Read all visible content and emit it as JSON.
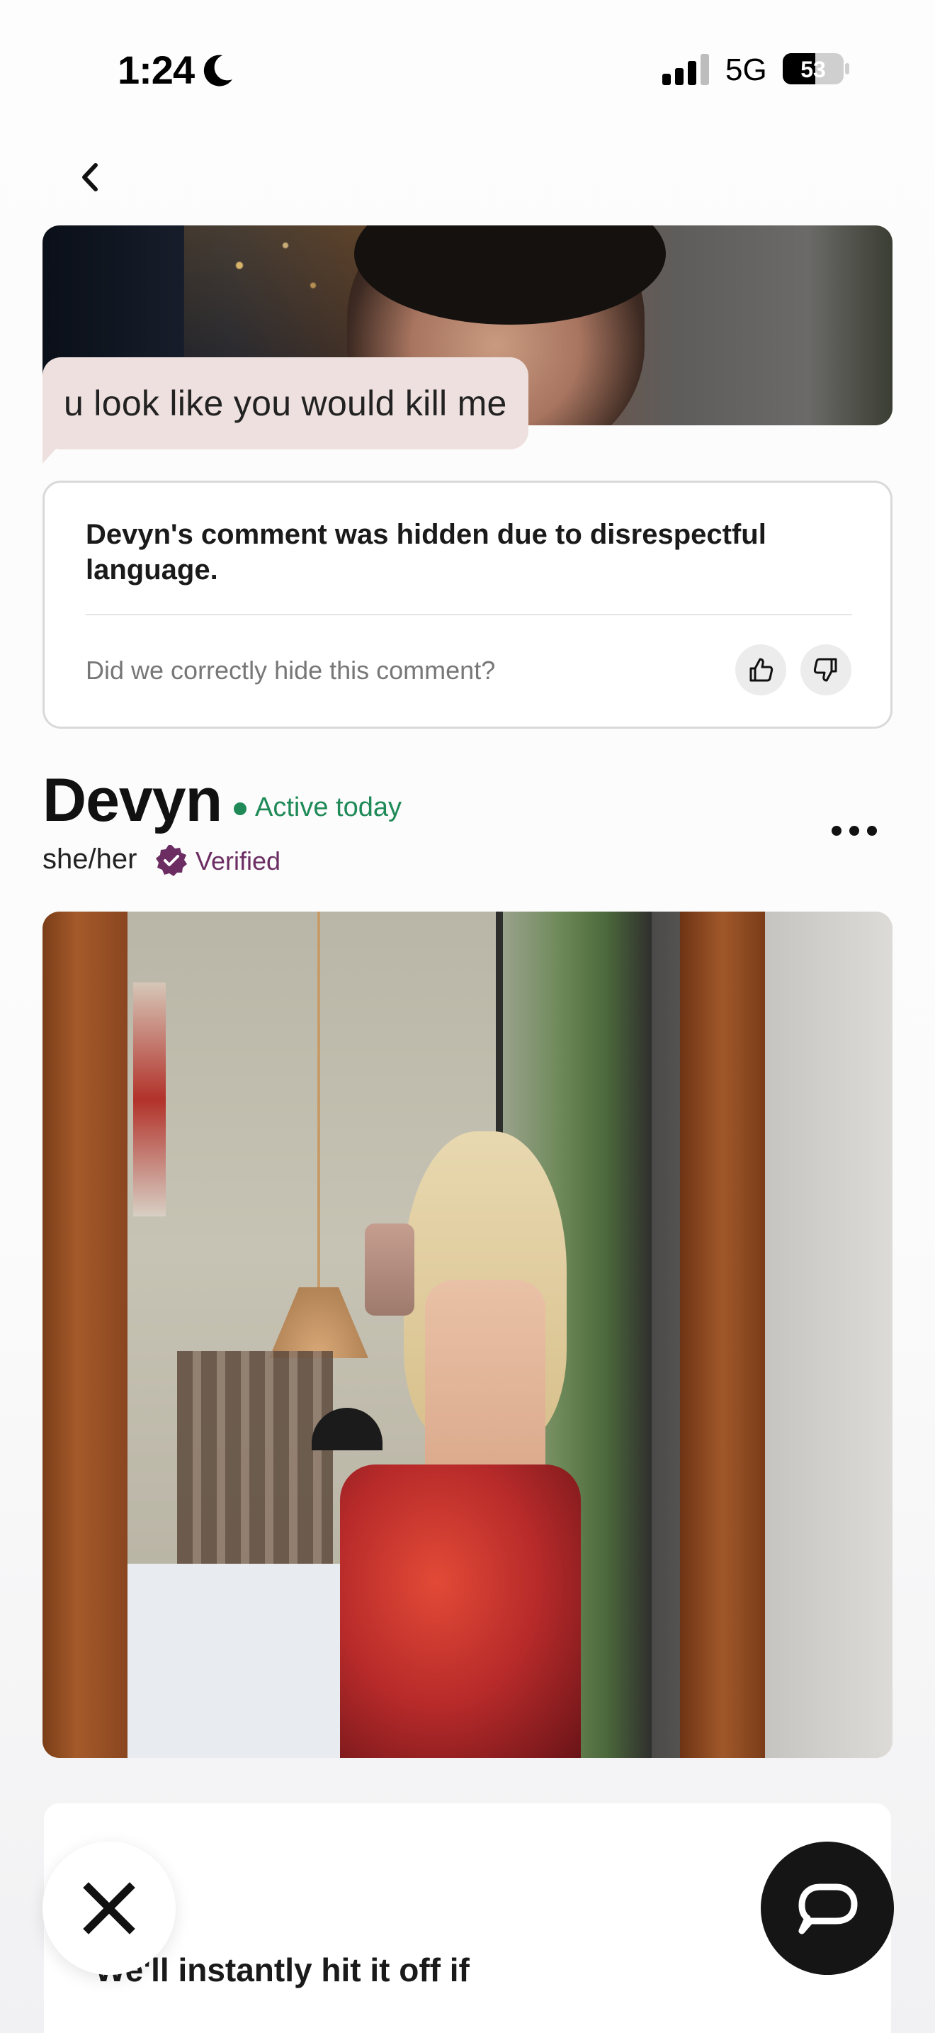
{
  "status_bar": {
    "time": "1:24",
    "network": "5G",
    "battery": "53"
  },
  "reply": {
    "comment": "u look like you would kill me"
  },
  "hidden_notice": {
    "message": "Devyn's comment was hidden due to disrespectful language.",
    "question": "Did we correctly hide this comment?"
  },
  "profile": {
    "name": "Devyn",
    "activity": "Active today",
    "pronouns": "she/her",
    "verified_label": "Verified"
  },
  "prompt": {
    "text": "We'll instantly hit it off if"
  },
  "icons": [
    "moon-icon",
    "signal-icon",
    "battery-icon",
    "back-chevron-icon",
    "thumbs-up-icon",
    "thumbs-down-icon",
    "verified-badge-icon",
    "more-icon",
    "close-icon",
    "comment-icon"
  ],
  "colors": {
    "active_green": "#1f8a58",
    "verified_purple": "#6b2d62",
    "bubble_bg": "#ede0de",
    "comment_button_bg": "#151515"
  }
}
